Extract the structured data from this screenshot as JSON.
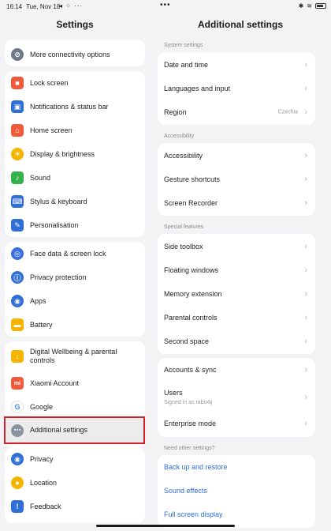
{
  "status_bar": {
    "time": "16:14",
    "date": "Tue, Nov 18",
    "icons_left": "◂ ⁘ ···",
    "dots": "•••",
    "icons_right": [
      "bluetooth-icon",
      "wifi-icon",
      "battery-icon"
    ]
  },
  "left": {
    "title": "Settings",
    "cards": [
      {
        "items": [
          {
            "label": "More connectivity options",
            "icon": "link-icon",
            "color": "#6f7b8a",
            "glyph": "⊘"
          }
        ]
      },
      {
        "items": [
          {
            "label": "Lock screen",
            "icon": "lock-icon",
            "color": "#f05a3c",
            "glyph": "■"
          },
          {
            "label": "Notifications & status bar",
            "icon": "notification-icon",
            "color": "#2f6fd6",
            "glyph": "▣"
          },
          {
            "label": "Home screen",
            "icon": "home-icon",
            "color": "#f05a3c",
            "glyph": "⌂"
          },
          {
            "label": "Display & brightness",
            "icon": "brightness-icon",
            "color": "#f4b400",
            "glyph": "☀"
          },
          {
            "label": "Sound",
            "icon": "sound-icon",
            "color": "#34b24c",
            "glyph": "♪"
          },
          {
            "label": "Stylus & keyboard",
            "icon": "keyboard-icon",
            "color": "#2f6fd6",
            "glyph": "⌨"
          },
          {
            "label": "Personalisation",
            "icon": "brush-icon",
            "color": "#2f6fd6",
            "glyph": "✎"
          }
        ]
      },
      {
        "items": [
          {
            "label": "Face data & screen lock",
            "icon": "fingerprint-icon",
            "color": "#3b6fe0",
            "glyph": "◎"
          },
          {
            "label": "Privacy protection",
            "icon": "privacy-icon",
            "color": "#2f6fd6",
            "glyph": "ⓘ"
          },
          {
            "label": "Apps",
            "icon": "apps-icon",
            "color": "#2f6fd6",
            "glyph": "◉"
          },
          {
            "label": "Battery",
            "icon": "battery-setting-icon",
            "color": "#f4b400",
            "glyph": "▬"
          }
        ]
      },
      {
        "items": [
          {
            "label": "Digital Wellbeing & parental controls",
            "icon": "wellbeing-icon",
            "color": "#f4b400",
            "glyph": "↓",
            "tall": true
          },
          {
            "label": "Xiaomi Account",
            "icon": "xiaomi-icon",
            "color": "#f05a3c",
            "glyph": "mi"
          },
          {
            "label": "Google",
            "icon": "google-icon",
            "color": "#ffffff",
            "glyph": "G"
          },
          {
            "label": "Additional settings",
            "icon": "more-icon",
            "color": "#8a93a0",
            "glyph": "⋯"
          }
        ]
      },
      {
        "items": [
          {
            "label": "Privacy",
            "icon": "eye-icon",
            "color": "#2f6fd6",
            "glyph": "◉"
          },
          {
            "label": "Location",
            "icon": "location-icon",
            "color": "#f4b400",
            "glyph": "●"
          },
          {
            "label": "Feedback",
            "icon": "feedback-icon",
            "color": "#2f6fd6",
            "glyph": "!"
          }
        ]
      }
    ]
  },
  "right": {
    "title": "Additional settings",
    "sections": {
      "system": "System settings",
      "accessibility": "Accessibility",
      "special": "Special features",
      "need_other": "Need other settings?"
    },
    "system_items": [
      {
        "label": "Date and time"
      },
      {
        "label": "Languages and input"
      },
      {
        "label": "Region",
        "value": "Czechia"
      }
    ],
    "accessibility_items": [
      {
        "label": "Accessibility"
      },
      {
        "label": "Gesture shortcuts"
      },
      {
        "label": "Screen Recorder"
      }
    ],
    "special_items": [
      {
        "label": "Side toolbox"
      },
      {
        "label": "Floating windows"
      },
      {
        "label": "Memory extension"
      },
      {
        "label": "Parental controls"
      },
      {
        "label": "Second space"
      }
    ],
    "account_items": [
      {
        "label": "Accounts & sync"
      },
      {
        "label": "Users",
        "sublabel": "Signed in as rabo4ij"
      },
      {
        "label": "Enterprise mode"
      }
    ],
    "links": [
      {
        "label": "Back up and restore"
      },
      {
        "label": "Sound effects"
      },
      {
        "label": "Full screen display"
      }
    ]
  }
}
